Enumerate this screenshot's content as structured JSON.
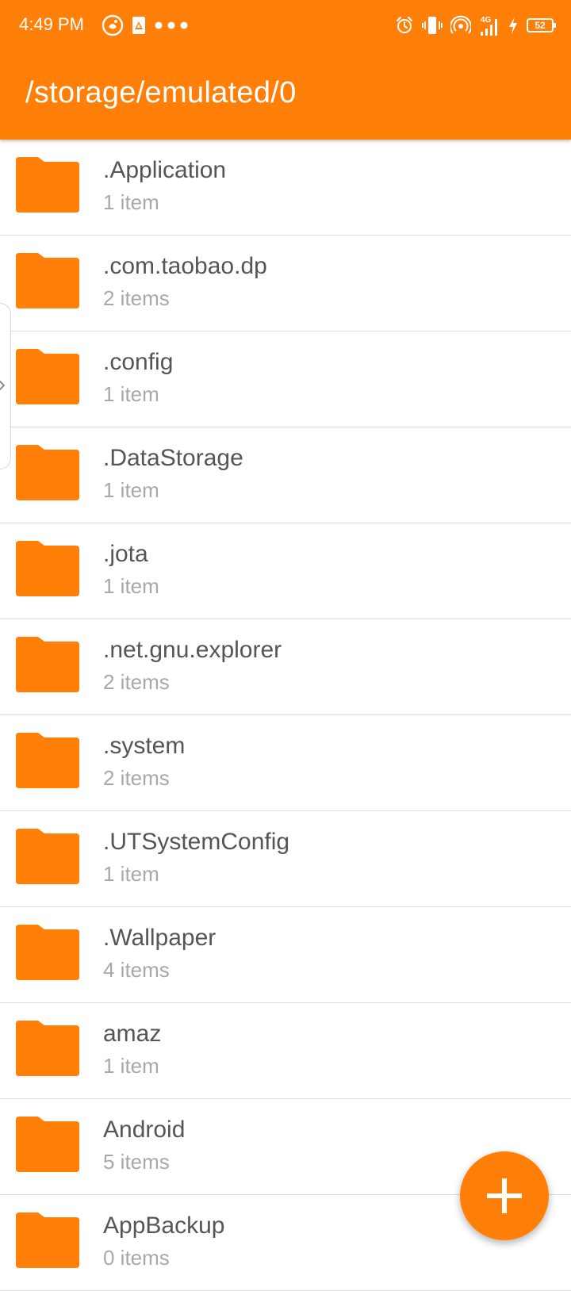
{
  "status_bar": {
    "time": "4:49 PM",
    "battery_level": "52",
    "network_label": "4G",
    "left_icons": [
      "weibo-icon",
      "drive-icon",
      "more-dots-icon"
    ],
    "right_icons": [
      "alarm-icon",
      "vibrate-icon",
      "hotspot-icon",
      "signal-icon",
      "charging-icon",
      "battery-icon"
    ]
  },
  "header": {
    "path": "/storage/emulated/0"
  },
  "colors": {
    "accent": "#FF7F08",
    "name_text": "#555555",
    "count_text": "#A8A8A8"
  },
  "folders": [
    {
      "name": ".Application",
      "count": "1 item"
    },
    {
      "name": ".com.taobao.dp",
      "count": "2 items"
    },
    {
      "name": ".config",
      "count": "1 item"
    },
    {
      "name": ".DataStorage",
      "count": "1 item"
    },
    {
      "name": ".jota",
      "count": "1 item"
    },
    {
      "name": ".net.gnu.explorer",
      "count": "2 items"
    },
    {
      "name": ".system",
      "count": "2 items"
    },
    {
      "name": ".UTSystemConfig",
      "count": "1 item"
    },
    {
      "name": ".Wallpaper",
      "count": "4 items"
    },
    {
      "name": "amaz",
      "count": "1 item"
    },
    {
      "name": "Android",
      "count": "5 items"
    },
    {
      "name": "AppBackup",
      "count": "0 items"
    }
  ],
  "fab": {
    "icon": "plus-icon"
  }
}
